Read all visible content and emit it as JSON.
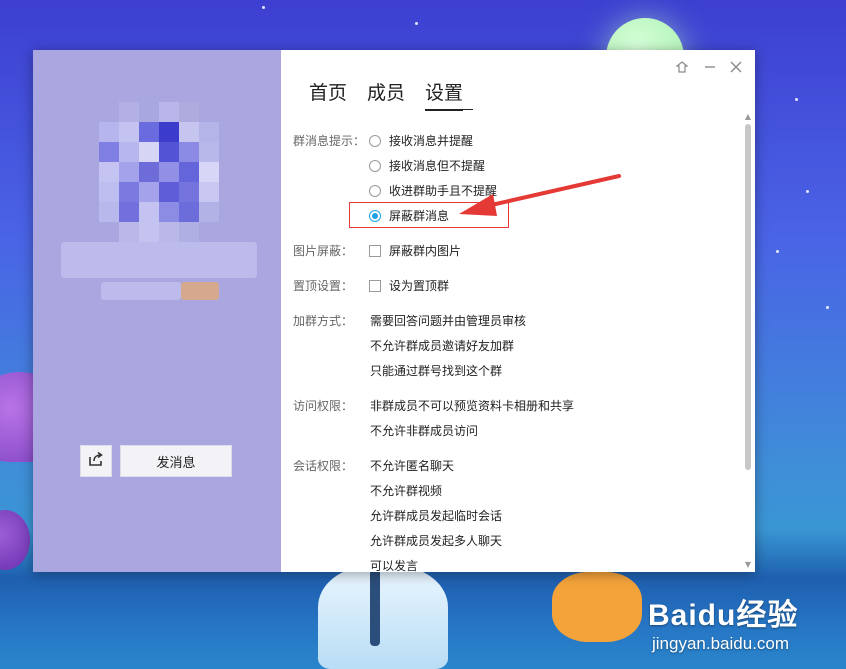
{
  "window": {
    "tabs": [
      "首页",
      "成员",
      "设置"
    ],
    "active_tab": 2
  },
  "left": {
    "send_message_label": "发消息",
    "share_icon": "share-icon"
  },
  "settings": {
    "group_message_prompt": {
      "label": "群消息提示：",
      "options": [
        "接收消息并提醒",
        "接收消息但不提醒",
        "收进群助手且不提醒",
        "屏蔽群消息"
      ],
      "selected_index": 3
    },
    "image_block": {
      "label": "图片屏蔽：",
      "option": "屏蔽群内图片",
      "checked": false
    },
    "pin": {
      "label": "置顶设置：",
      "option": "设为置顶群",
      "checked": false
    },
    "join_method": {
      "label": "加群方式：",
      "lines": [
        "需要回答问题并由管理员审核",
        "不允许群成员邀请好友加群",
        "只能通过群号找到这个群"
      ]
    },
    "access": {
      "label": "访问权限：",
      "lines": [
        "非群成员不可以预览资料卡相册和共享",
        "不允许非群成员访问"
      ]
    },
    "chat": {
      "label": "会话权限：",
      "lines": [
        "不允许匿名聊天",
        "不允许群视频",
        "允许群成员发起临时会话",
        "允许群成员发起多人聊天",
        "可以发言"
      ]
    }
  },
  "watermark": {
    "brand": "Baidu经验",
    "url": "jingyan.baidu.com"
  },
  "colors": {
    "accent": "#1fa0e6",
    "highlight": "#e53935",
    "left_pane": "#a9a6e0"
  }
}
